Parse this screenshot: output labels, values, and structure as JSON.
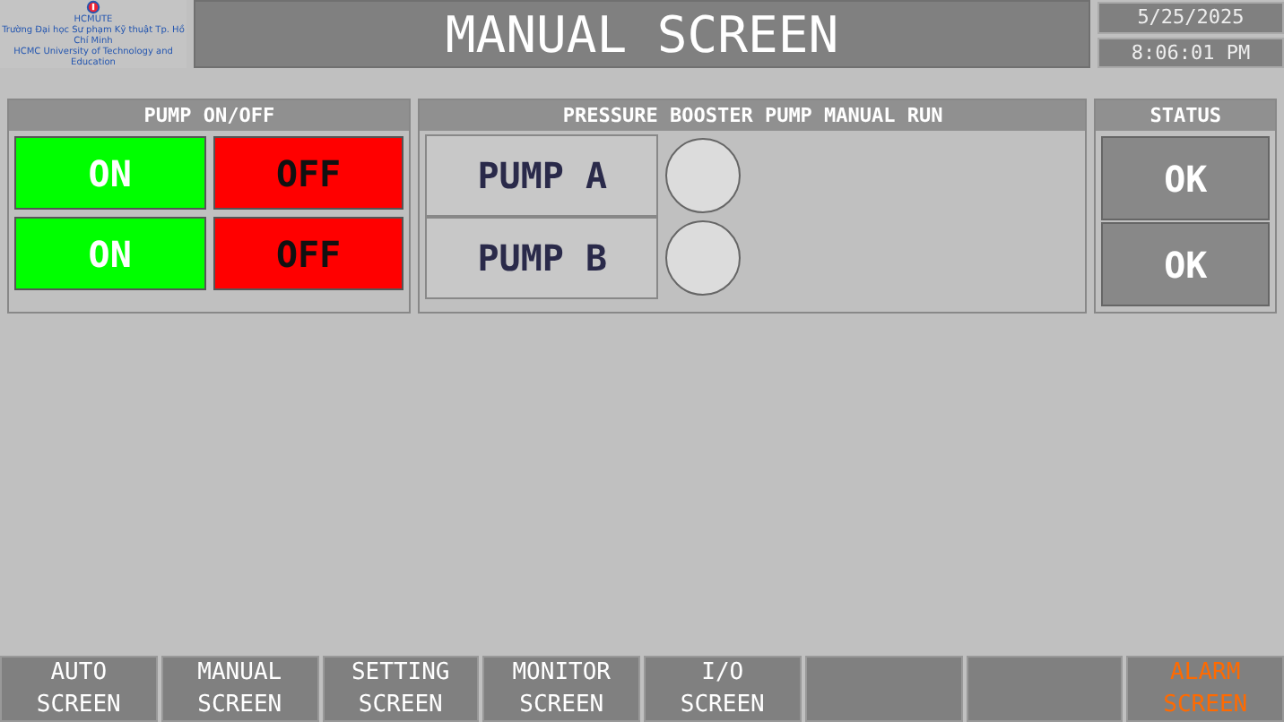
{
  "header": {
    "logo": {
      "acronym": "HCMUTE",
      "line_1": "Trường Đại học Sư phạm Kỹ thuật Tp. Hồ Chí Minh",
      "line_2": "HCMC University of Technology and Education"
    },
    "title": "MANUAL SCREEN",
    "date": "5/25/2025",
    "time": "8:06:01 PM"
  },
  "pump_onoff": {
    "title": "PUMP ON/OFF",
    "rows": [
      {
        "on": "ON",
        "off": "OFF"
      },
      {
        "on": "ON",
        "off": "OFF"
      }
    ]
  },
  "manual_run": {
    "title": "PRESSURE BOOSTER PUMP MANUAL RUN",
    "pumps": [
      {
        "label": "PUMP A",
        "running": false
      },
      {
        "label": "PUMP B",
        "running": false
      }
    ]
  },
  "status": {
    "title": "STATUS",
    "items": [
      "OK",
      "OK"
    ]
  },
  "nav": [
    {
      "kind": "screen",
      "label": "AUTO\nSCREEN",
      "alarm": false
    },
    {
      "kind": "screen",
      "label": "MANUAL\nSCREEN",
      "alarm": false
    },
    {
      "kind": "screen",
      "label": "SETTING\nSCREEN",
      "alarm": false
    },
    {
      "kind": "screen",
      "label": "MONITOR\nSCREEN",
      "alarm": false
    },
    {
      "kind": "screen",
      "label": "I/O\nSCREEN",
      "alarm": false
    },
    {
      "kind": "blank"
    },
    {
      "kind": "blank"
    },
    {
      "kind": "screen",
      "label": "ALARM\nSCREEN",
      "alarm": true
    }
  ]
}
